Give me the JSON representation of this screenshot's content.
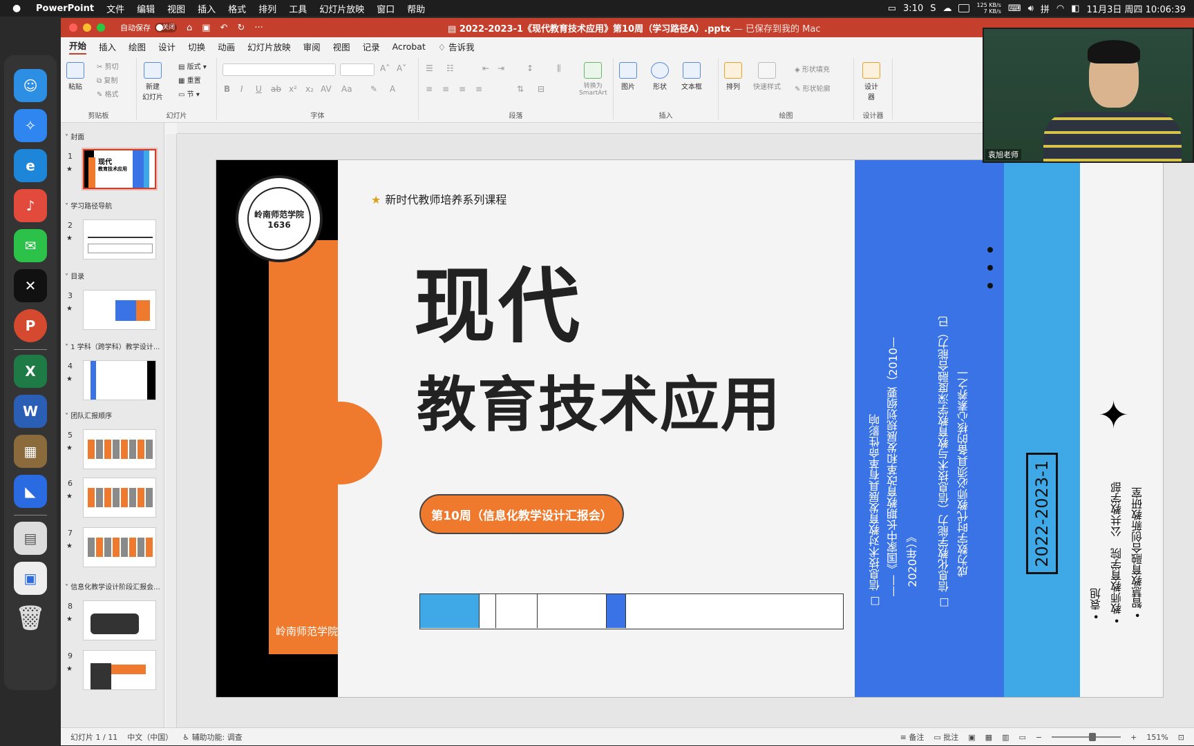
{
  "menubar": {
    "app": "PowerPoint",
    "items": [
      "文件",
      "编辑",
      "视图",
      "插入",
      "格式",
      "排列",
      "工具",
      "幻灯片放映",
      "窗口",
      "帮助"
    ],
    "battery_time": "3:10",
    "net_up": "125 KB/s",
    "net_down": "7 KB/s",
    "ime": "拼",
    "clock": "11月3日 周四 10:06:39"
  },
  "titlebar": {
    "autosave_label": "自动保存",
    "autosave_state": "关闭",
    "doc_title": "2022-2023-1《现代教育技术应用》第10周（学习路径A）.pptx",
    "saved_status": "— 已保存到我的 Mac"
  },
  "ribbon_tabs": [
    "开始",
    "插入",
    "绘图",
    "设计",
    "切换",
    "动画",
    "幻灯片放映",
    "审阅",
    "视图",
    "记录",
    "Acrobat",
    "告诉我"
  ],
  "ribbon": {
    "paste": "粘贴",
    "cut": "剪切",
    "copy": "复制",
    "format": "格式",
    "clipboard_group": "剪贴板",
    "new_slide": "新建\n幻灯片",
    "layout": "版式",
    "reset": "重置",
    "section": "节",
    "slides_group": "幻灯片",
    "font_group": "字体",
    "paragraph_group": "段落",
    "smartart": "转换为\nSmartArt",
    "picture": "图片",
    "shapes": "形状",
    "textbox": "文本框",
    "insert_group": "插入",
    "arrange": "排列",
    "quick_styles": "快速样式",
    "shape_fill": "形状填充",
    "shape_outline": "形状轮廓",
    "drawing_group": "绘图",
    "designer": "设计\n器",
    "designer_group": "设计器"
  },
  "slide_pane": {
    "sections": [
      {
        "name": "封面",
        "slides": [
          1
        ]
      },
      {
        "name": "学习路径导航",
        "slides": [
          2
        ]
      },
      {
        "name": "目录",
        "slides": [
          3
        ]
      },
      {
        "name": "1 学科（跨学科）教学设计...",
        "slides": [
          4
        ]
      },
      {
        "name": "团队汇报顺序",
        "slides": [
          5,
          6,
          7
        ]
      },
      {
        "name": "信息化教学设计阶段汇报会...",
        "slides": [
          8,
          9
        ]
      }
    ],
    "thumb1_title": "现代",
    "thumb1_sub": "教育技术应用",
    "star": "★"
  },
  "slide": {
    "series": "新时代教师培养系列课程",
    "title1": "现代",
    "title2": "教育技术应用",
    "week": "第10周（信息化教学设计汇报会）",
    "school": "岭南师范学院",
    "seal_text": "岭南师范学院",
    "seal_year": "1636",
    "panel_line1": "☐ 信息技术对教育发展具有革命性影响",
    "panel_line2": "——《国家中长期教育改革和发展规划纲要（2010—",
    "panel_line3": "2020年）》",
    "panel_line4": "☐ 信息化教学能力（信息技术与教育教学深度融合能力）已",
    "panel_line5": "成为数字时代教师必须具备的核心素养之一",
    "date": "2022-2023-1",
    "author1": "• 袁旭",
    "author2": "• 教师教育学院　公共教学部",
    "author3": "• 智慧教育融合创新教研室",
    "compass": "✦"
  },
  "statusbar": {
    "slide_count": "幻灯片 1 / 11",
    "language": "中文（中国）",
    "accessibility": "辅助功能: 调查",
    "notes": "备注",
    "comments": "批注",
    "zoom": "151%"
  },
  "webcam": {
    "name": "袁旭老师"
  },
  "colors": {
    "ppt_red": "#c4402d",
    "orange": "#ef7a2e",
    "blue": "#3a73e6",
    "sky": "#3fa9e8"
  }
}
